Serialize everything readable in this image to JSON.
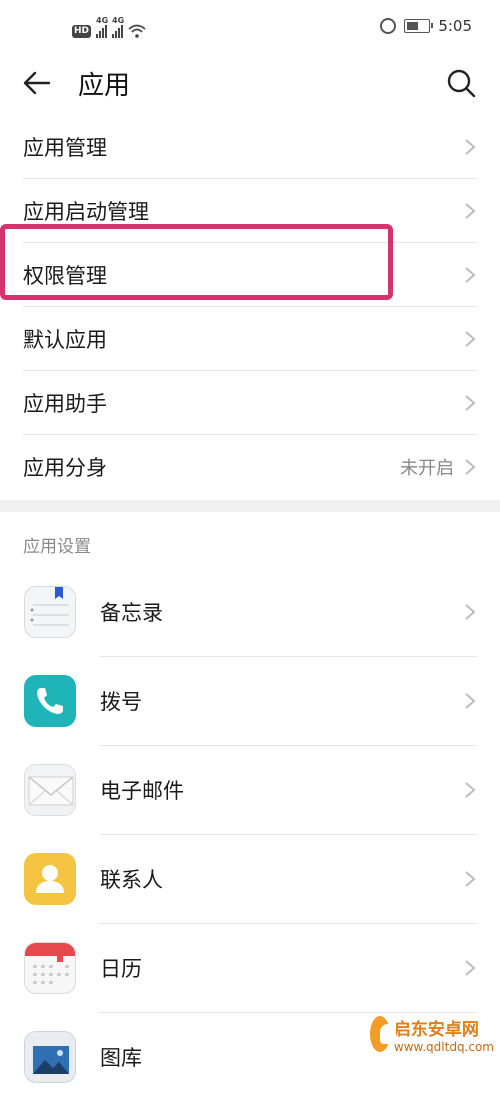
{
  "status_bar": {
    "hd_label": "HD",
    "network_1": "4G",
    "network_2": "4G",
    "time": "5:05"
  },
  "header": {
    "title": "应用"
  },
  "menu": [
    {
      "label": "应用管理"
    },
    {
      "label": "应用启动管理"
    },
    {
      "label": "权限管理"
    },
    {
      "label": "默认应用"
    },
    {
      "label": "应用助手"
    },
    {
      "label": "应用分身",
      "value": "未开启"
    }
  ],
  "section_title": "应用设置",
  "apps": [
    {
      "label": "备忘录",
      "icon": "notes-icon"
    },
    {
      "label": "拨号",
      "icon": "phone-icon"
    },
    {
      "label": "电子邮件",
      "icon": "mail-icon"
    },
    {
      "label": "联系人",
      "icon": "contacts-icon"
    },
    {
      "label": "日历",
      "icon": "calendar-icon"
    },
    {
      "label": "图库",
      "icon": "gallery-icon"
    }
  ],
  "watermark": {
    "title": "启东安卓网",
    "url": "www.qdltdq.com"
  },
  "colors": {
    "highlight": "#d6336c",
    "phone": "#1fb5b8",
    "contacts": "#f6c443",
    "calendar": "#e5484d"
  }
}
